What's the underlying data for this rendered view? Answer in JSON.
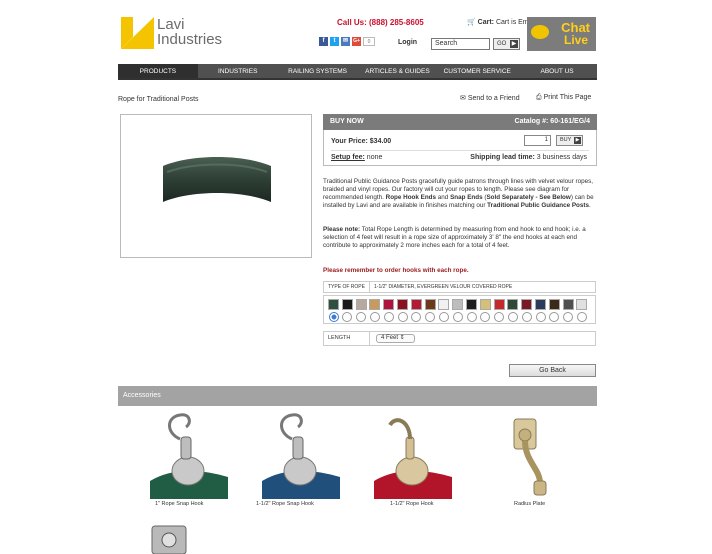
{
  "header": {
    "logo_line1": "Lavi",
    "logo_line2": "Industries",
    "phone": "Call Us: (888) 285-8605",
    "cart_label": "Cart:",
    "cart_status": "Cart is Empty",
    "share_count": "0",
    "login": "Login",
    "search_value": "Search",
    "go": "GO",
    "chat_line1": "Chat",
    "chat_line2": "Live"
  },
  "nav": [
    "PRODUCTS",
    "INDUSTRIES",
    "RAILING SYSTEMS",
    "ARTICLES & GUIDES",
    "CUSTOMER SERVICE",
    "ABOUT US"
  ],
  "page": {
    "title": "Rope for Traditional Posts",
    "send_friend": "Send to a Friend",
    "print_page": "Print This Page"
  },
  "buy": {
    "heading": "BUY NOW",
    "catalog": "Catalog #: 60-161/EG/4",
    "price_label": "Your Price:",
    "price_value": "$34.00",
    "qty": "1",
    "buy_button": "BUY",
    "setup_label": "Setup fee:",
    "setup_value": "none",
    "lead_label": "Shipping lead time:",
    "lead_value": "3 business days"
  },
  "description": {
    "p1_a": "Traditional Public Guidance Posts gracefully guide patrons through lines with velvet velour ropes, braided and vinyl ropes. Our factory will cut your ropes to length. Please see diagram for recommended length. ",
    "p1_b": "Rope Hook Ends",
    "p1_c": " and ",
    "p1_d": "Snap Ends",
    "p1_e": " (",
    "p1_f": "Sold Separately - See Below",
    "p1_g": ") can be installed by Lavi and are available in finishes matching our ",
    "p1_h": "Traditional Public Guidance Posts",
    "p1_i": ".",
    "note_label": "Please note:",
    "note_text": " Total Rope Length is determined by measuring from end hook to end hook; i.e. a selection of 4 feet will result in a rope size of approximately 3' 8\" the end hooks at each end contribute to approximately 2 more inches each for a total of 4 feet.",
    "remember": "Please remember to order hooks with each rope."
  },
  "options": {
    "rope_type_label": "TYPE OF ROPE",
    "rope_type_value": "1-1/2\" DIAMETER, EVERGREEN VELOUR COVERED ROPE",
    "swatch_colors": [
      "#2f4f3f",
      "#1a1a1a",
      "#b7a8a0",
      "#c89a60",
      "#b0123a",
      "#8b1020",
      "#b21b33",
      "#6a3a1a",
      "#f1f1f1",
      "#bdbdbd",
      "#1e1e1e",
      "#d5c07a",
      "#c52a2a",
      "#2e4a35",
      "#7a1825",
      "#2a3a5a",
      "#3c2a18",
      "#4f4f4f",
      "#e0e0e0"
    ],
    "selected_swatch": 0,
    "length_label": "LENGTH",
    "length_value": "4 Feet"
  },
  "go_back": "Go Back",
  "accessories": {
    "heading": "Accessories",
    "items": [
      "1\" Rope Snap Hook",
      "1-1/2\" Rope Snap Hook",
      "1-1/2\" Rope Hook",
      "Radius Plate"
    ]
  },
  "colors": {
    "brand_yellow": "#f5c400",
    "phone_red": "#c8102e",
    "nav_bg": "#505050",
    "accessories_bar": "#a3a3a3"
  }
}
